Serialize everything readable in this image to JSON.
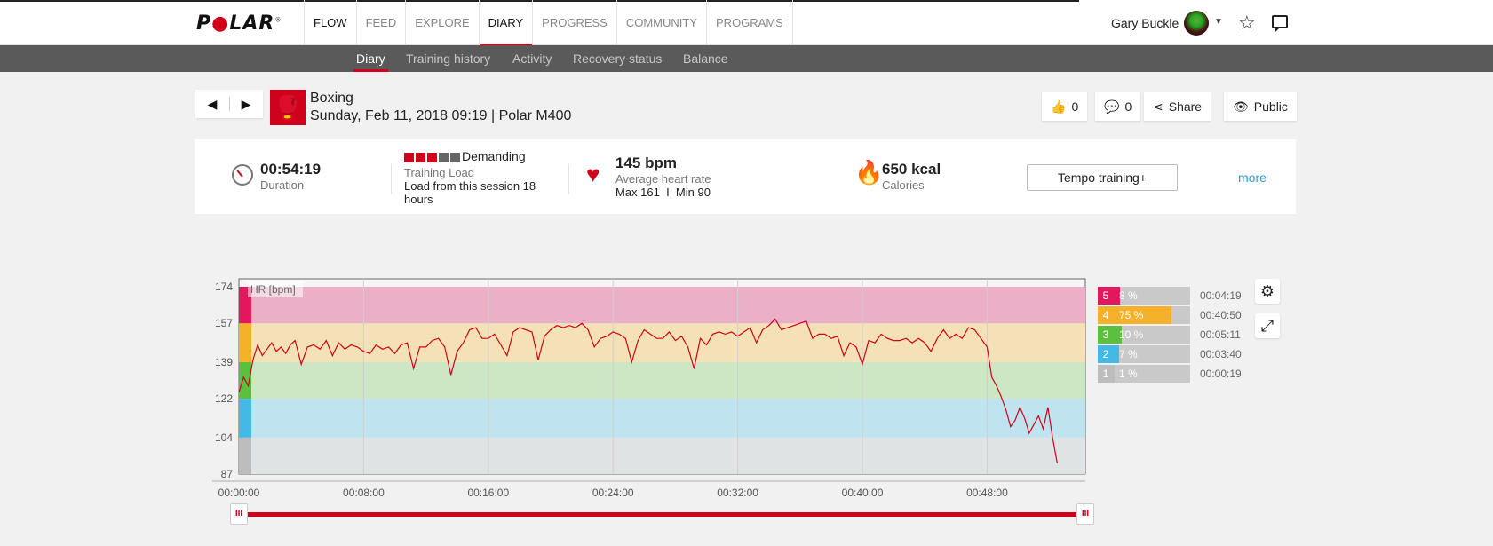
{
  "brand": {
    "logo_left": "P",
    "logo_o": "●",
    "logo_right": "LAR",
    "reg": "®"
  },
  "nav": {
    "items": [
      {
        "label": "FLOW"
      },
      {
        "label": "FEED"
      },
      {
        "label": "EXPLORE"
      },
      {
        "label": "DIARY"
      },
      {
        "label": "PROGRESS"
      },
      {
        "label": "COMMUNITY"
      },
      {
        "label": "PROGRAMS"
      }
    ],
    "active": "DIARY",
    "user_name": "Gary Buckle"
  },
  "subnav": {
    "items": [
      {
        "label": "Diary"
      },
      {
        "label": "Training history"
      },
      {
        "label": "Activity"
      },
      {
        "label": "Recovery status"
      },
      {
        "label": "Balance"
      }
    ],
    "active": "Diary"
  },
  "session": {
    "sport": "Boxing",
    "date_device": "Sunday, Feb 11, 2018 09:19 | Polar M400",
    "likes": "0",
    "comments": "0",
    "share_label": "Share",
    "visibility_label": "Public"
  },
  "summary": {
    "duration_value": "00:54:19",
    "duration_label": "Duration",
    "load_level": "Demanding",
    "load_label": "Training Load",
    "load_detail": "Load from this session 18 hours",
    "load_boxes_filled": 3,
    "load_boxes_total": 5,
    "hr_value": "145 bpm",
    "hr_label": "Average heart rate",
    "hr_minmax": "Max 161  I  Min 90",
    "calories_value": "650 kcal",
    "calories_label": "Calories",
    "benefit_button": "Tempo training+",
    "more_link": "more"
  },
  "colors": {
    "brand_red": "#d0021b",
    "zone5": "#e0185e",
    "zone4": "#f6b12a",
    "zone3": "#5cc03e",
    "zone2": "#45b9e6",
    "zone1": "#bdbdbd"
  },
  "zones": [
    {
      "num": "5",
      "pct_label": "8 %",
      "pct": 8,
      "time": "00:04:19"
    },
    {
      "num": "4",
      "pct_label": "75 %",
      "pct": 75,
      "time": "00:40:50"
    },
    {
      "num": "3",
      "pct_label": "10 %",
      "pct": 10,
      "time": "00:05:11"
    },
    {
      "num": "2",
      "pct_label": "7 %",
      "pct": 7,
      "time": "00:03:40"
    },
    {
      "num": "1",
      "pct_label": "1 %",
      "pct": 1,
      "time": "00:00:19"
    }
  ],
  "chart_data": {
    "type": "line",
    "series_label": "HR [bpm]",
    "y_ticks": [
      "174",
      "157",
      "139",
      "122",
      "104",
      "87"
    ],
    "x_ticks": [
      "00:00:00",
      "00:08:00",
      "00:16:00",
      "00:24:00",
      "00:32:00",
      "00:40:00",
      "00:48:00"
    ],
    "ylim": [
      87,
      174
    ],
    "xlim_minutes": [
      0,
      54.3
    ],
    "zone_bounds": [
      87,
      104,
      122,
      139,
      157,
      174
    ],
    "zone_colors": [
      "#e0e3e4",
      "#bfe3ef",
      "#cde6c3",
      "#f4e1b8",
      "#ebb0c8"
    ],
    "series": [
      {
        "x_min": [
          0,
          0.3,
          0.6,
          0.9,
          1.2,
          1.5,
          1.8,
          2.1,
          2.4,
          2.7,
          3.0,
          3.3,
          3.6,
          4.0,
          4.4,
          4.8,
          5.2,
          5.6,
          6.0,
          6.4,
          6.8,
          7.2,
          7.6,
          8.0,
          8.4,
          8.8,
          9.2,
          9.6,
          10.0,
          10.4,
          10.8,
          11.2,
          11.6,
          12.0,
          12.4,
          12.8,
          13.2,
          13.6,
          14.0,
          14.4,
          14.8,
          15.2,
          15.6,
          16.0,
          16.4,
          16.8,
          17.2,
          17.6,
          18.0,
          18.4,
          18.8,
          19.2,
          19.6,
          20.0,
          20.4,
          20.8,
          21.2,
          21.6,
          22.0,
          22.4,
          22.8,
          23.2,
          23.6,
          24.0,
          24.4,
          24.8,
          25.2,
          25.6,
          26.0,
          26.4,
          26.8,
          27.2,
          27.6,
          28.0,
          28.4,
          28.8,
          29.2,
          29.6,
          30.0,
          30.4,
          30.8,
          31.2,
          31.6,
          32.0,
          32.4,
          32.8,
          33.2,
          33.6,
          34.0,
          34.4,
          34.8,
          35.2,
          35.6,
          36.0,
          36.4,
          36.8,
          37.2,
          37.6,
          38.0,
          38.4,
          38.8,
          39.2,
          39.6,
          40.0,
          40.4,
          40.8,
          41.2,
          41.6,
          42.0,
          42.4,
          42.8,
          43.2,
          43.6,
          44.0,
          44.4,
          44.8,
          45.2,
          45.6,
          46.0,
          46.4,
          46.8,
          47.2,
          47.6,
          48.0,
          48.3,
          48.6,
          48.9,
          49.2,
          49.5,
          49.8,
          50.1,
          50.4,
          50.7,
          51.0,
          51.3,
          51.6,
          51.9,
          52.2,
          52.5,
          52.8,
          53.1,
          53.4,
          53.7,
          54.0,
          54.3
        ],
        "hr": [
          125,
          132,
          128,
          140,
          147,
          142,
          145,
          148,
          144,
          146,
          143,
          147,
          149,
          138,
          146,
          147,
          145,
          149,
          142,
          148,
          145,
          147,
          146,
          144,
          143,
          147,
          145,
          146,
          143,
          147,
          148,
          136,
          146,
          146,
          149,
          150,
          146,
          133,
          144,
          148,
          154,
          155,
          150,
          150,
          152,
          147,
          142,
          153,
          155,
          154,
          153,
          140,
          151,
          154,
          156,
          155,
          156,
          155,
          157,
          154,
          146,
          150,
          151,
          153,
          152,
          150,
          139,
          149,
          154,
          152,
          150,
          150,
          153,
          149,
          151,
          146,
          136,
          150,
          147,
          152,
          153,
          152,
          153,
          151,
          153,
          155,
          148,
          154,
          156,
          159,
          154,
          155,
          156,
          157,
          158,
          150,
          152,
          152,
          150,
          151,
          142,
          148,
          146,
          138,
          149,
          148,
          152,
          150,
          149,
          149,
          150,
          148,
          150,
          148,
          144,
          150,
          154,
          150,
          152,
          150,
          155,
          154,
          150,
          146,
          132,
          128,
          123,
          117,
          109,
          112,
          118,
          113,
          106,
          110,
          114,
          108,
          118,
          104,
          92
        ]
      }
    ]
  }
}
